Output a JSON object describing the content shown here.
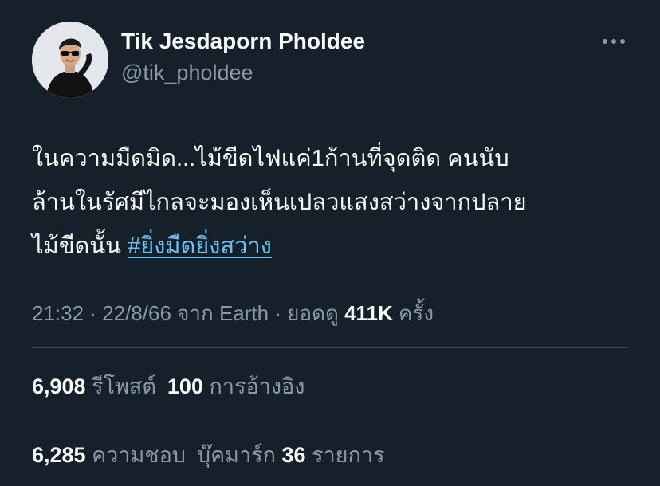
{
  "author": {
    "name": "Tik Jesdaporn Pholdee",
    "handle": "@tik_pholdee"
  },
  "more_icon": "ellipsis-icon",
  "tweet": {
    "line1": "ในความมืดมิด...ไม้ขีดไฟแค่1ก้านที่จุดติด คนนับ",
    "line2": "ล้านในรัศมีไกลจะมองเห็นเปลวแสงสว่างจากปลาย",
    "line3_prefix": "ไม้ขีดนั้น ",
    "hashtag": "#ยิ่งมืดยิ่งสว่าง"
  },
  "meta": {
    "time": "21:32",
    "separator": " · ",
    "date": "22/8/66",
    "source_prefix": " จาก ",
    "source": "Earth",
    "views_label": " ยอดดู ",
    "views": "411K",
    "views_suffix": " ครั้ง"
  },
  "stats": {
    "retweets": "6,908",
    "retweets_label": " รีโพสต์",
    "quotes": "100",
    "quotes_label": " การอ้างอิง",
    "likes": "6,285",
    "likes_label": " ความชอบ",
    "bookmarks_label": "บุ๊คมาร์ก ",
    "bookmarks": "36",
    "bookmarks_suffix": " รายการ"
  },
  "colors": {
    "background": "#15202b",
    "text": "#f7f9f9",
    "secondary": "#8b98a5",
    "link": "#6cc1f0",
    "divider": "#38444d"
  }
}
